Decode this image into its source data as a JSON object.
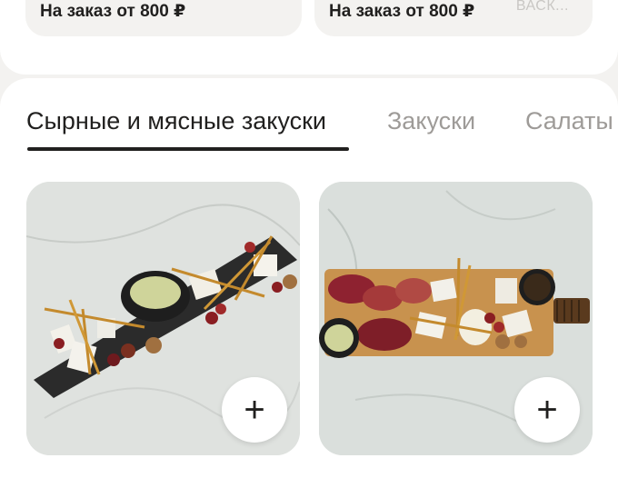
{
  "restaurants": [
    {
      "order_min": "На заказ от 800 ₽"
    },
    {
      "order_min": "На заказ от 800 ₽",
      "faded_text": "ВАСК..."
    }
  ],
  "tabs": [
    {
      "label": "Сырные и мясные закуски",
      "active": true
    },
    {
      "label": "Закуски",
      "active": false
    },
    {
      "label": "Салаты",
      "active": false
    }
  ],
  "products": [
    {
      "image": "cheese-platter-photo",
      "add_label": "+"
    },
    {
      "image": "meat-cheese-board-photo",
      "add_label": "+"
    }
  ],
  "colors": {
    "text": "#21201f",
    "inactive_tab": "#9e9b98",
    "background": "#f3f2f0"
  }
}
